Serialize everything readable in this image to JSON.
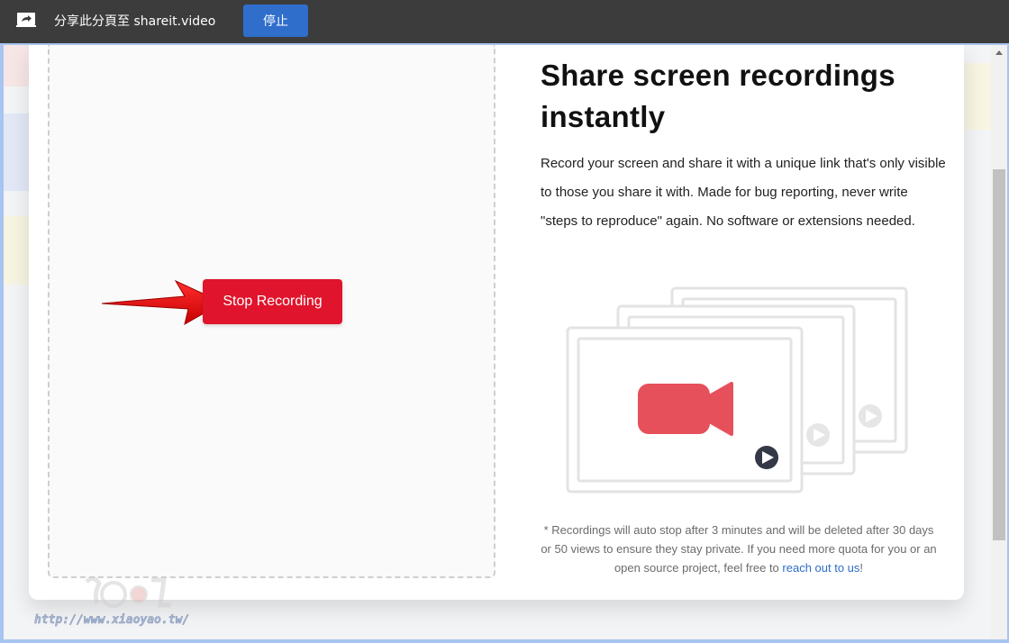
{
  "share_bar": {
    "icon": "screen-share-icon",
    "text": "分享此分頁至 shareit.video",
    "stop_label": "停止",
    "stop_color": "#2f6ecb"
  },
  "page": {
    "stop_recording_label": "Stop Recording",
    "stop_recording_color": "#e0142c",
    "headline_line1": "Share screen recordings",
    "headline_line2": "instantly",
    "description": "Record your screen and share it with a unique link that's only visible to those you share it with. Made for bug reporting, never write \"steps to reproduce\" again. No software or extensions needed.",
    "footnote_text": "* Recordings will auto stop after 3 minutes and will be deleted after 30 days or 50 views to ensure they stay private. If you need more quota for you or an open source project, feel free to ",
    "footnote_link": "reach out to us",
    "footnote_end": "!",
    "link_color": "#2d6cc8"
  },
  "icons": {
    "annotation": "red-arrow-icon",
    "illustration": "video-frames-illustration",
    "camera": "video-camera-icon",
    "play": "play-icon"
  },
  "watermark": {
    "text": "http://www.xiaoyao.tw/"
  }
}
